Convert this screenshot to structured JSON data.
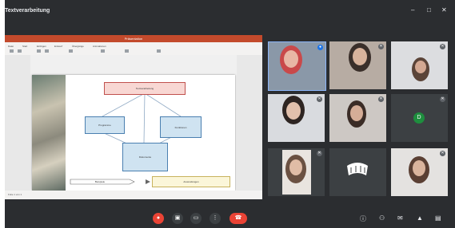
{
  "window": {
    "title": "Textverarbeitung"
  },
  "presentation": {
    "titlebar": "Präsentation",
    "tabs": [
      "Datei",
      "Start",
      "Einfügen",
      "Entwurf",
      "Übergänge",
      "Animationen",
      "Bildschirmpräsentation",
      "Überprüfen",
      "Ansicht",
      "Hilfe"
    ],
    "status_text": "Folie 1 von 1",
    "diagram": {
      "top_box": "Textverarbeitung",
      "left_box": "Programme",
      "right_box": "Funktionen",
      "center_box": "Dokumente",
      "bottom_left_box": "Beispiele",
      "bottom_right_box": "Anwendungen"
    }
  },
  "participants": [
    {
      "name": "",
      "mic": "on"
    },
    {
      "name": "",
      "mic": "off"
    },
    {
      "name": "",
      "mic": "off"
    },
    {
      "name": "",
      "mic": "off"
    },
    {
      "name": "",
      "mic": "off"
    },
    {
      "name": "",
      "initial": "D",
      "mic": "off"
    },
    {
      "name": "",
      "mic": "off"
    },
    {
      "name": "",
      "mic": "off"
    },
    {
      "name": "",
      "mic": "off"
    }
  ],
  "bottombar": {
    "time": "",
    "controls": [
      "mic-off",
      "camera",
      "present",
      "more",
      "end-call"
    ]
  },
  "colors": {
    "end_call": "#ea4335",
    "mic_off": "#ea4335",
    "title_bar": "#c34a2c"
  }
}
